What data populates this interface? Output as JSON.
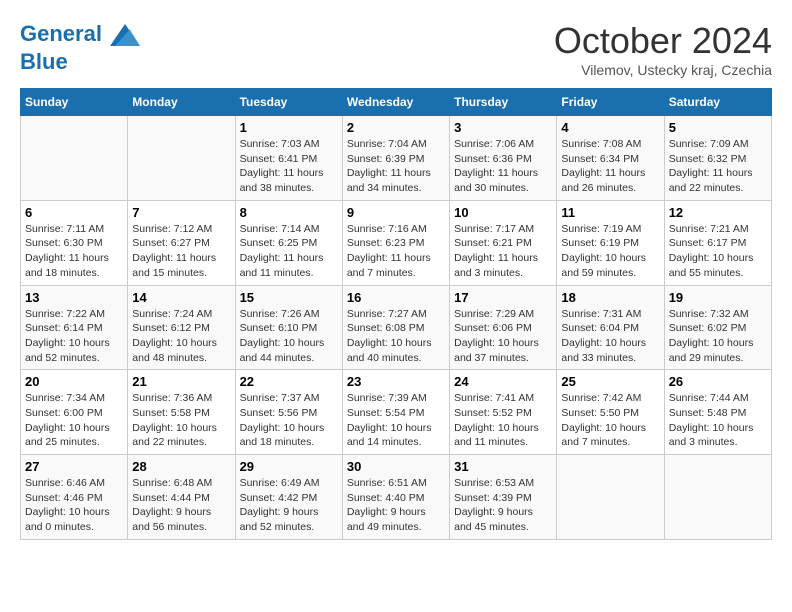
{
  "header": {
    "logo_line1": "General",
    "logo_line2": "Blue",
    "month": "October 2024",
    "location": "Vilemov, Ustecky kraj, Czechia"
  },
  "weekdays": [
    "Sunday",
    "Monday",
    "Tuesday",
    "Wednesday",
    "Thursday",
    "Friday",
    "Saturday"
  ],
  "weeks": [
    [
      {
        "day": "",
        "info": ""
      },
      {
        "day": "",
        "info": ""
      },
      {
        "day": "1",
        "sunrise": "Sunrise: 7:03 AM",
        "sunset": "Sunset: 6:41 PM",
        "daylight": "Daylight: 11 hours and 38 minutes."
      },
      {
        "day": "2",
        "sunrise": "Sunrise: 7:04 AM",
        "sunset": "Sunset: 6:39 PM",
        "daylight": "Daylight: 11 hours and 34 minutes."
      },
      {
        "day": "3",
        "sunrise": "Sunrise: 7:06 AM",
        "sunset": "Sunset: 6:36 PM",
        "daylight": "Daylight: 11 hours and 30 minutes."
      },
      {
        "day": "4",
        "sunrise": "Sunrise: 7:08 AM",
        "sunset": "Sunset: 6:34 PM",
        "daylight": "Daylight: 11 hours and 26 minutes."
      },
      {
        "day": "5",
        "sunrise": "Sunrise: 7:09 AM",
        "sunset": "Sunset: 6:32 PM",
        "daylight": "Daylight: 11 hours and 22 minutes."
      }
    ],
    [
      {
        "day": "6",
        "sunrise": "Sunrise: 7:11 AM",
        "sunset": "Sunset: 6:30 PM",
        "daylight": "Daylight: 11 hours and 18 minutes."
      },
      {
        "day": "7",
        "sunrise": "Sunrise: 7:12 AM",
        "sunset": "Sunset: 6:27 PM",
        "daylight": "Daylight: 11 hours and 15 minutes."
      },
      {
        "day": "8",
        "sunrise": "Sunrise: 7:14 AM",
        "sunset": "Sunset: 6:25 PM",
        "daylight": "Daylight: 11 hours and 11 minutes."
      },
      {
        "day": "9",
        "sunrise": "Sunrise: 7:16 AM",
        "sunset": "Sunset: 6:23 PM",
        "daylight": "Daylight: 11 hours and 7 minutes."
      },
      {
        "day": "10",
        "sunrise": "Sunrise: 7:17 AM",
        "sunset": "Sunset: 6:21 PM",
        "daylight": "Daylight: 11 hours and 3 minutes."
      },
      {
        "day": "11",
        "sunrise": "Sunrise: 7:19 AM",
        "sunset": "Sunset: 6:19 PM",
        "daylight": "Daylight: 10 hours and 59 minutes."
      },
      {
        "day": "12",
        "sunrise": "Sunrise: 7:21 AM",
        "sunset": "Sunset: 6:17 PM",
        "daylight": "Daylight: 10 hours and 55 minutes."
      }
    ],
    [
      {
        "day": "13",
        "sunrise": "Sunrise: 7:22 AM",
        "sunset": "Sunset: 6:14 PM",
        "daylight": "Daylight: 10 hours and 52 minutes."
      },
      {
        "day": "14",
        "sunrise": "Sunrise: 7:24 AM",
        "sunset": "Sunset: 6:12 PM",
        "daylight": "Daylight: 10 hours and 48 minutes."
      },
      {
        "day": "15",
        "sunrise": "Sunrise: 7:26 AM",
        "sunset": "Sunset: 6:10 PM",
        "daylight": "Daylight: 10 hours and 44 minutes."
      },
      {
        "day": "16",
        "sunrise": "Sunrise: 7:27 AM",
        "sunset": "Sunset: 6:08 PM",
        "daylight": "Daylight: 10 hours and 40 minutes."
      },
      {
        "day": "17",
        "sunrise": "Sunrise: 7:29 AM",
        "sunset": "Sunset: 6:06 PM",
        "daylight": "Daylight: 10 hours and 37 minutes."
      },
      {
        "day": "18",
        "sunrise": "Sunrise: 7:31 AM",
        "sunset": "Sunset: 6:04 PM",
        "daylight": "Daylight: 10 hours and 33 minutes."
      },
      {
        "day": "19",
        "sunrise": "Sunrise: 7:32 AM",
        "sunset": "Sunset: 6:02 PM",
        "daylight": "Daylight: 10 hours and 29 minutes."
      }
    ],
    [
      {
        "day": "20",
        "sunrise": "Sunrise: 7:34 AM",
        "sunset": "Sunset: 6:00 PM",
        "daylight": "Daylight: 10 hours and 25 minutes."
      },
      {
        "day": "21",
        "sunrise": "Sunrise: 7:36 AM",
        "sunset": "Sunset: 5:58 PM",
        "daylight": "Daylight: 10 hours and 22 minutes."
      },
      {
        "day": "22",
        "sunrise": "Sunrise: 7:37 AM",
        "sunset": "Sunset: 5:56 PM",
        "daylight": "Daylight: 10 hours and 18 minutes."
      },
      {
        "day": "23",
        "sunrise": "Sunrise: 7:39 AM",
        "sunset": "Sunset: 5:54 PM",
        "daylight": "Daylight: 10 hours and 14 minutes."
      },
      {
        "day": "24",
        "sunrise": "Sunrise: 7:41 AM",
        "sunset": "Sunset: 5:52 PM",
        "daylight": "Daylight: 10 hours and 11 minutes."
      },
      {
        "day": "25",
        "sunrise": "Sunrise: 7:42 AM",
        "sunset": "Sunset: 5:50 PM",
        "daylight": "Daylight: 10 hours and 7 minutes."
      },
      {
        "day": "26",
        "sunrise": "Sunrise: 7:44 AM",
        "sunset": "Sunset: 5:48 PM",
        "daylight": "Daylight: 10 hours and 3 minutes."
      }
    ],
    [
      {
        "day": "27",
        "sunrise": "Sunrise: 6:46 AM",
        "sunset": "Sunset: 4:46 PM",
        "daylight": "Daylight: 10 hours and 0 minutes."
      },
      {
        "day": "28",
        "sunrise": "Sunrise: 6:48 AM",
        "sunset": "Sunset: 4:44 PM",
        "daylight": "Daylight: 9 hours and 56 minutes."
      },
      {
        "day": "29",
        "sunrise": "Sunrise: 6:49 AM",
        "sunset": "Sunset: 4:42 PM",
        "daylight": "Daylight: 9 hours and 52 minutes."
      },
      {
        "day": "30",
        "sunrise": "Sunrise: 6:51 AM",
        "sunset": "Sunset: 4:40 PM",
        "daylight": "Daylight: 9 hours and 49 minutes."
      },
      {
        "day": "31",
        "sunrise": "Sunrise: 6:53 AM",
        "sunset": "Sunset: 4:39 PM",
        "daylight": "Daylight: 9 hours and 45 minutes."
      },
      {
        "day": "",
        "info": ""
      },
      {
        "day": "",
        "info": ""
      }
    ]
  ]
}
